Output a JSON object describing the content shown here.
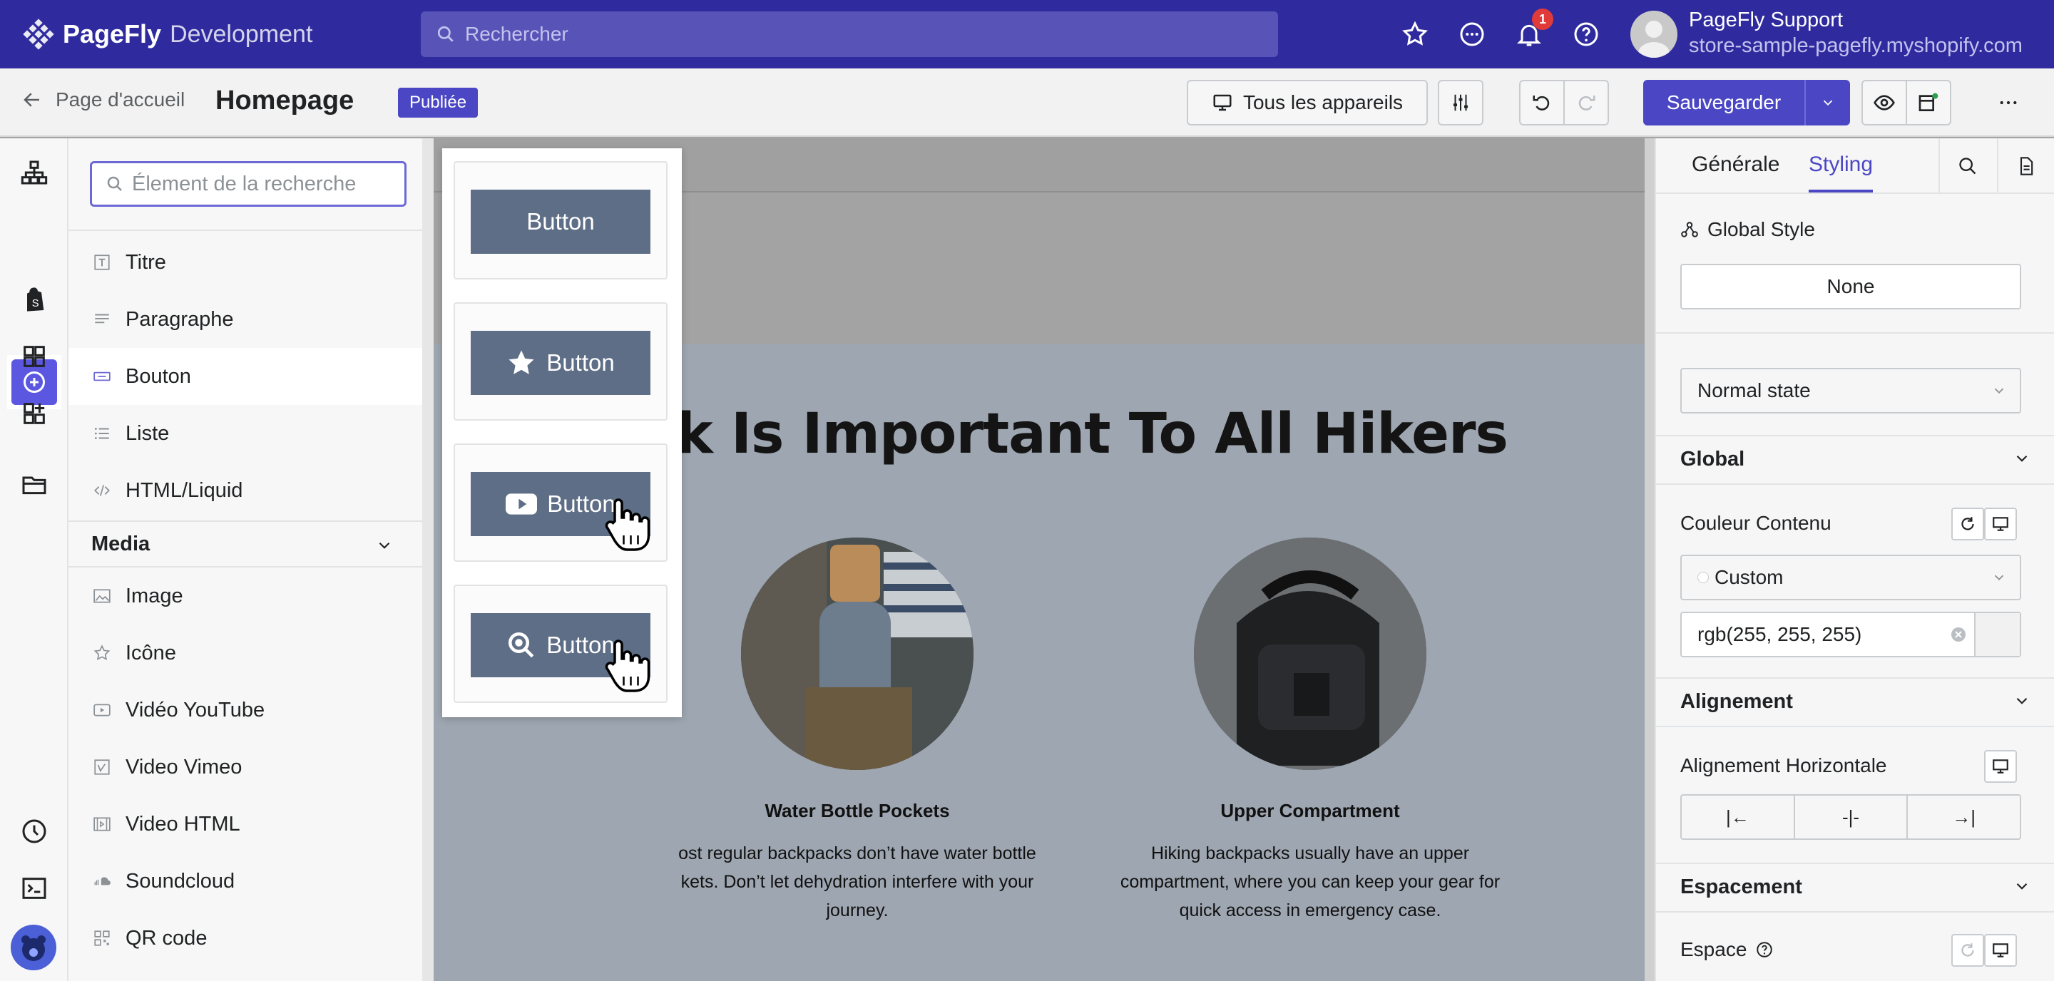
{
  "app": {
    "brand": "PageFly",
    "env": "Development"
  },
  "topbar": {
    "search_placeholder": "Rechercher",
    "notification_count": "1",
    "user_name": "PageFly Support",
    "user_store": "store-sample-pagefly.myshopify.com"
  },
  "toolbar": {
    "back_label": "Page d'accueil",
    "page_title": "Homepage",
    "status": "Publiée",
    "devices_label": "Tous les appareils",
    "save_label": "Sauvegarder"
  },
  "elements_panel": {
    "search_placeholder": "Élement de la recherche",
    "basic_items": [
      {
        "label": "Titre",
        "icon": "title-icon"
      },
      {
        "label": "Paragraphe",
        "icon": "paragraph-icon"
      },
      {
        "label": "Bouton",
        "icon": "button-icon",
        "selected": true
      },
      {
        "label": "Liste",
        "icon": "list-icon"
      },
      {
        "label": "HTML/Liquid",
        "icon": "code-icon"
      }
    ],
    "media_heading": "Media",
    "media_items": [
      {
        "label": "Image",
        "icon": "image-icon"
      },
      {
        "label": "Icône",
        "icon": "star-icon"
      },
      {
        "label": "Vidéo YouTube",
        "icon": "youtube-icon"
      },
      {
        "label": "Video Vimeo",
        "icon": "vimeo-icon"
      },
      {
        "label": "Video HTML",
        "icon": "video-icon"
      },
      {
        "label": "Soundcloud",
        "icon": "soundcloud-icon"
      },
      {
        "label": "QR code",
        "icon": "qrcode-icon"
      }
    ]
  },
  "button_variants": [
    {
      "label": "Button",
      "icon": ""
    },
    {
      "label": "Button",
      "icon": "star-icon"
    },
    {
      "label": "Button",
      "icon": "youtube-icon"
    },
    {
      "label": "Button",
      "icon": "search-icon"
    }
  ],
  "canvas": {
    "heading": "k Is Important To All Hikers",
    "features": [
      {
        "title": "Water Bottle Pockets",
        "desc": "ost regular backpacks don’t have water bottle\nkets. Don’t let dehydration interfere with your\njourney."
      },
      {
        "title": "Upper Compartment",
        "desc": "Hiking backpacks usually have an upper\ncompartment, where you can keep your gear for\nquick access in emergency case."
      }
    ]
  },
  "style_panel": {
    "tab_general": "Générale",
    "tab_styling": "Styling",
    "global_style_label": "Global Style",
    "global_style_value": "None",
    "state_value": "Normal state",
    "global_heading": "Global",
    "content_color_label": "Couleur Contenu",
    "color_mode": "Custom",
    "color_value": "rgb(255, 255, 255)",
    "alignment_heading": "Alignement",
    "horizontal_alignment_label": "Alignement Horizontale",
    "align_options": [
      "|←",
      "-|-",
      "→|"
    ],
    "spacing_heading": "Espacement",
    "space_label": "Espace"
  },
  "colors": {
    "primary": "#4b47c4",
    "topbar": "#2f2b9e",
    "button": "#5e6e86"
  }
}
